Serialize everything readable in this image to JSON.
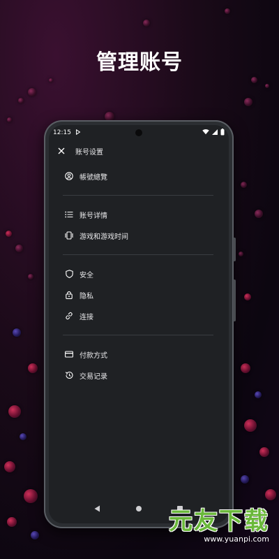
{
  "headline": "管理账号",
  "status_bar": {
    "time": "12:15"
  },
  "top_bar": {
    "title": "账号设置"
  },
  "sections": [
    {
      "items": [
        {
          "label": "帳號總覽",
          "icon": "account-circle-icon"
        }
      ]
    },
    {
      "items": [
        {
          "label": "账号详情",
          "icon": "list-icon"
        },
        {
          "label": "游戏和游戏时间",
          "icon": "game-icon"
        }
      ]
    },
    {
      "items": [
        {
          "label": "安全",
          "icon": "shield-icon"
        },
        {
          "label": "隐私",
          "icon": "lock-icon"
        },
        {
          "label": "连接",
          "icon": "link-icon"
        }
      ]
    },
    {
      "items": [
        {
          "label": "付款方式",
          "icon": "credit-card-icon"
        },
        {
          "label": "交易记录",
          "icon": "history-icon"
        }
      ]
    }
  ],
  "watermark": {
    "title": "元友下载",
    "url": "www.yuanpi.com"
  },
  "colors": {
    "screen_bg": "#1f2124",
    "text": "#e8e8ea",
    "divider": "#3a3d42",
    "watermark_green": "#6ab83a"
  }
}
